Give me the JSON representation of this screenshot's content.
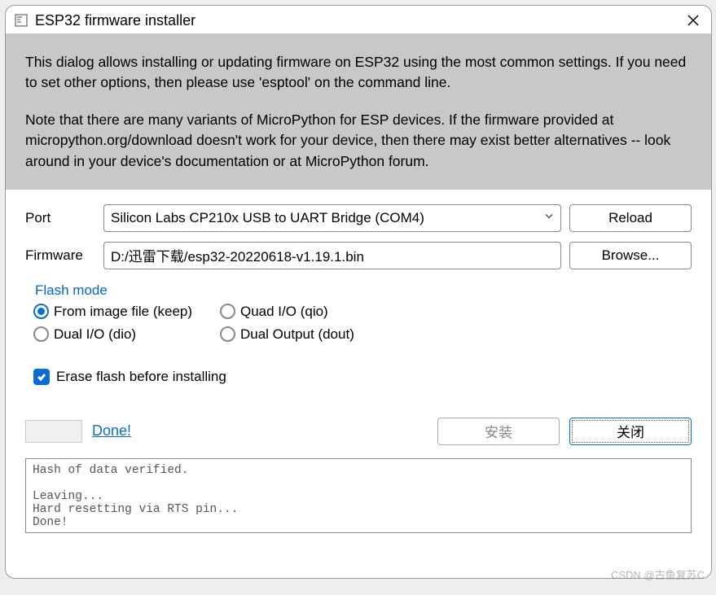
{
  "window": {
    "title": "ESP32 firmware installer"
  },
  "intro": {
    "p1": "This dialog allows installing or updating firmware on ESP32 using the most common settings. If you need to set other options, then please use 'esptool' on the command line.",
    "p2": "Note that there are many variants of MicroPython for ESP devices. If the firmware provided at micropython.org/download doesn't work for your device, then there may exist better alternatives -- look around in your device's documentation or at MicroPython forum."
  },
  "form": {
    "port_label": "Port",
    "port_value": "Silicon Labs CP210x USB to UART Bridge (COM4)",
    "reload_label": "Reload",
    "firmware_label": "Firmware",
    "firmware_value": "D:/迅雷下载/esp32-20220618-v1.19.1.bin",
    "browse_label": "Browse..."
  },
  "flash_mode": {
    "legend": "Flash mode",
    "options": [
      {
        "label": "From image file (keep)",
        "selected": true
      },
      {
        "label": "Quad I/O (qio)",
        "selected": false
      },
      {
        "label": "Dual I/O (dio)",
        "selected": false
      },
      {
        "label": "Dual Output (dout)",
        "selected": false
      }
    ]
  },
  "erase": {
    "label": "Erase flash before installing",
    "checked": true
  },
  "actions": {
    "done": "Done!",
    "install": "安装",
    "close": "关闭"
  },
  "log": {
    "text": "Hash of data verified.\n\nLeaving...\nHard resetting via RTS pin...\nDone!"
  },
  "watermark": "CSDN @古鱼复苏C"
}
